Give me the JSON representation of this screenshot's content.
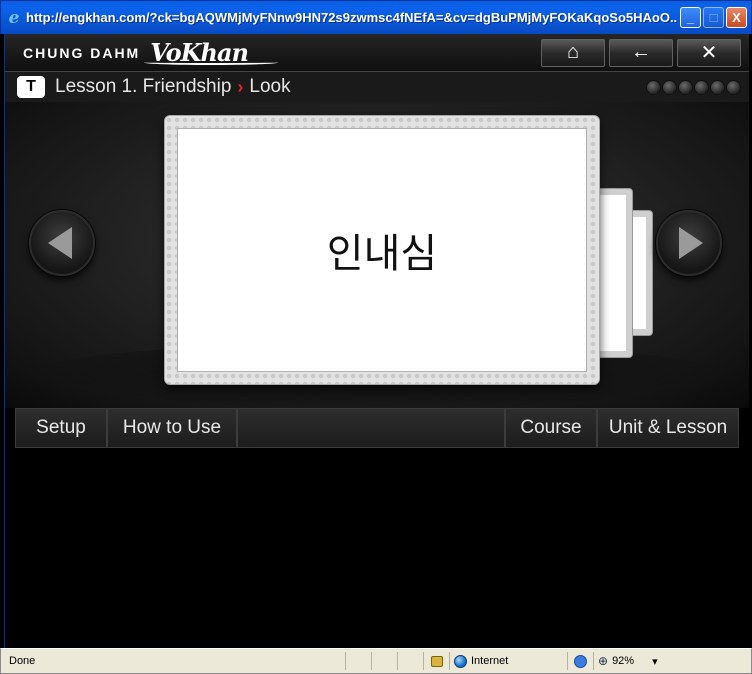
{
  "window": {
    "title": "http://engkhan.com/?ck=bgAQWMjMyFNnw9HN72s9zwmsc4fNEfA=&cv=dgBuPMjMyFOKaKqoSo5HAoO...",
    "controls": {
      "minimize": "_",
      "maximize": "□",
      "close": "X"
    }
  },
  "header": {
    "brand": "CHUNG DAHM",
    "logo": "VoKhan",
    "buttons": {
      "home": "⌂",
      "back": "←",
      "close": "✕"
    }
  },
  "lesson": {
    "badge": "T",
    "title": "Lesson 1. Friendship",
    "separator": "›",
    "section": "Look",
    "progress_dots": 6
  },
  "card": {
    "word": "인내심"
  },
  "menu": {
    "setup": "Setup",
    "how_to_use": "How to Use",
    "course": "Course",
    "unit_lesson": "Unit & Lesson"
  },
  "statusbar": {
    "status": "Done",
    "zone": "Internet",
    "zoom": "92%",
    "zoom_dropdown": "▾"
  },
  "colors": {
    "accent_red": "#e0261f",
    "title_bar_blue": "#0a5ee0",
    "status_bg": "#ece9d8"
  }
}
